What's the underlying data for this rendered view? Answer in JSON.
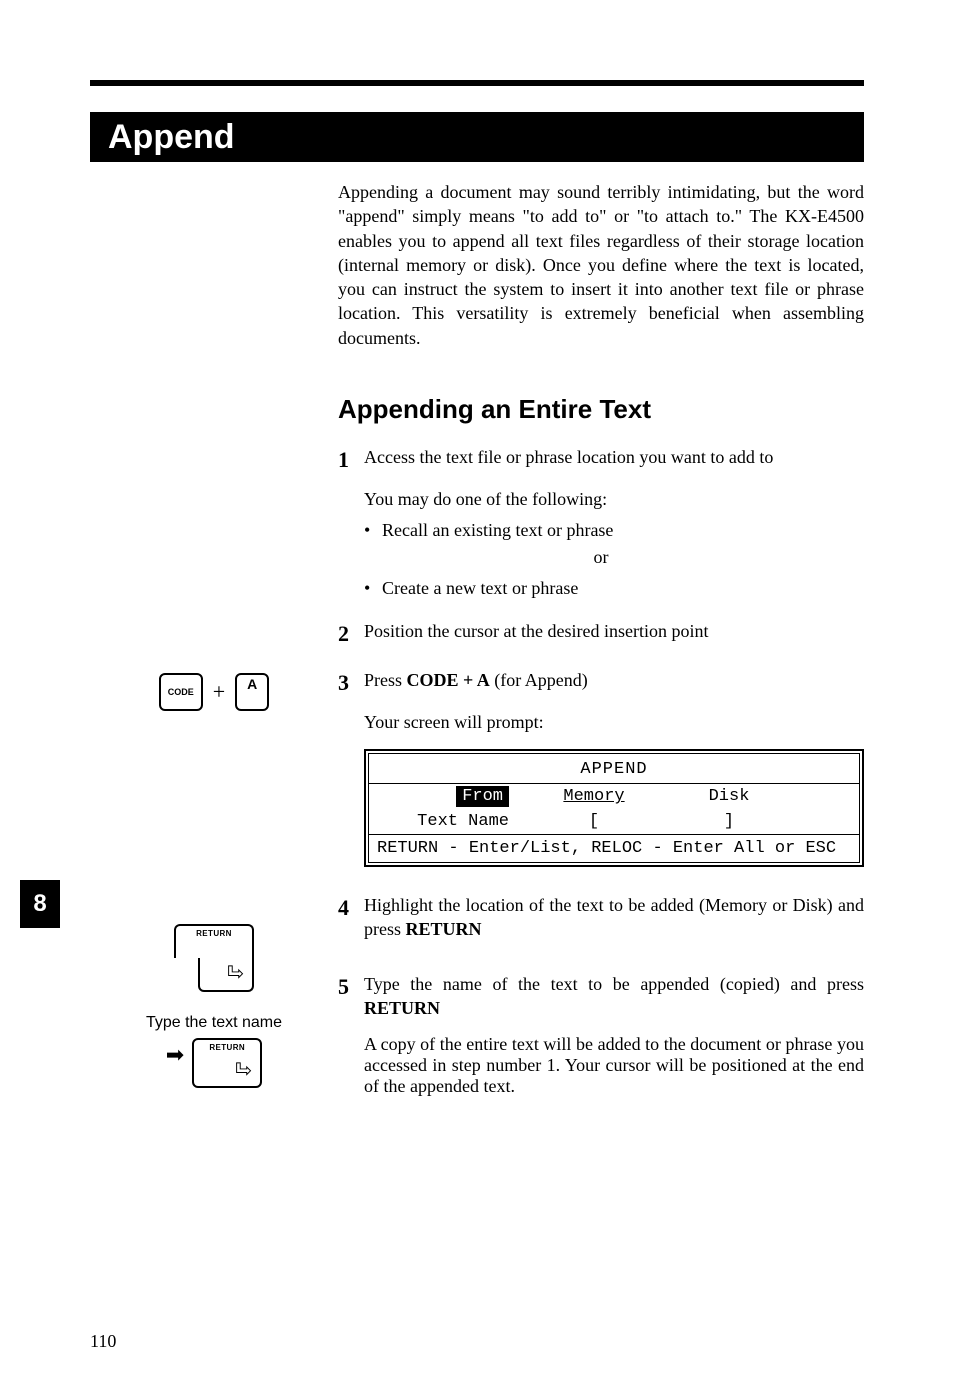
{
  "header": {
    "title": "Append"
  },
  "tab": "8",
  "page_number": "110",
  "intro": "Appending a document may sound terribly intimidating, but the word \"append\" simply means \"to add to\" or \"to attach to.\" The KX-E4500 enables you to append all text files regardless of their storage location (internal memory or disk). Once you define where the text is located, you can instruct the system to insert it into another text file or phrase location. This versatility is extremely beneficial when assembling documents.",
  "section_heading": "Appending an Entire Text",
  "steps": {
    "s1": {
      "num": "1",
      "text": "Access the text file or phrase location you want to add to"
    },
    "s1_sub": "You may do one of the following:",
    "s1_b1": "Recall an existing text or phrase",
    "s1_or": "or",
    "s1_b2": "Create a new text or phrase",
    "s2": {
      "num": "2",
      "text": "Position the cursor at the desired insertion point"
    },
    "s3": {
      "num": "3",
      "pre": "Press ",
      "code": "CODE + A",
      "post": " (for Append)"
    },
    "s3_prompt": "Your screen will prompt:",
    "s4": {
      "num": "4",
      "pre": "Highlight the location of the text to be added (Memory or Disk) and press ",
      "key": "RETURN"
    },
    "s5": {
      "num": "5",
      "pre": "Type the name of the text to be appended (copied) and press ",
      "key": "RETURN"
    },
    "s5_after": "A copy of the entire text will be added to the document or phrase you accessed in step number 1. Your cursor will be positioned at the end of the appended text."
  },
  "screen": {
    "title": "APPEND",
    "from_label": "From",
    "memory": "Memory",
    "disk": "Disk",
    "textname_label": "Text Name",
    "bracket_open": "[",
    "bracket_close": "]",
    "footer": "RETURN - Enter/List, RELOC - Enter All or ESC"
  },
  "left": {
    "code_key": "CODE",
    "a_key": "A",
    "plus": "+",
    "return_label": "RETURN",
    "type_label": "Type the text name",
    "arrow_glyph": "➡",
    "return_arrow_glyph": "⏎"
  }
}
